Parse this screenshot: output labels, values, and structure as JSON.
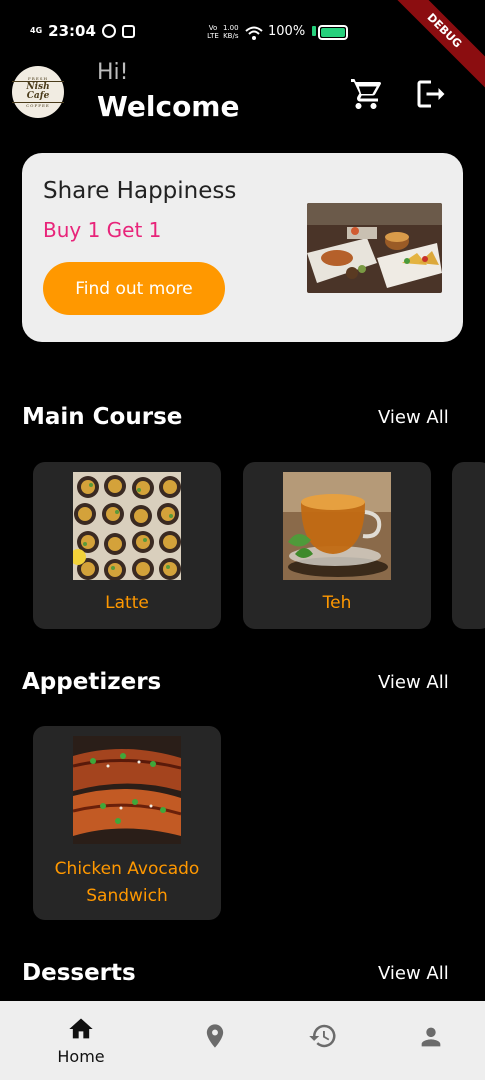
{
  "status_bar": {
    "network": "4G",
    "time": "23:04",
    "lte_label": "Vo LTE",
    "speed": "1.00",
    "speed_unit": "KB/s",
    "battery": "100%"
  },
  "debug_banner": "DEBUG",
  "header": {
    "logo_top": "FRESH",
    "logo_name": "Nish Cafe",
    "logo_bottom": "COFFEE",
    "greeting": "Hi!",
    "welcome": "Welcome",
    "cart_icon": "cart-icon",
    "logout_icon": "logout-icon"
  },
  "promo": {
    "title": "Share Happiness",
    "subtitle": "Buy 1 Get 1",
    "button_label": "Find out more",
    "accent_color": "#e8247a",
    "button_color": "#ff9800"
  },
  "sections": [
    {
      "title": "Main Course",
      "view_all": "View All",
      "items": [
        {
          "name": "Latte"
        },
        {
          "name": "Teh"
        }
      ]
    },
    {
      "title": "Appetizers",
      "view_all": "View All",
      "items": [
        {
          "name": "Chicken Avocado Sandwich"
        }
      ]
    },
    {
      "title": "Desserts",
      "view_all": "View All",
      "items": []
    }
  ],
  "bottom_nav": {
    "items": [
      {
        "icon": "home-icon",
        "label": "Home",
        "active": true
      },
      {
        "icon": "location-icon",
        "label": "",
        "active": false
      },
      {
        "icon": "history-icon",
        "label": "",
        "active": false
      },
      {
        "icon": "profile-icon",
        "label": "",
        "active": false
      }
    ]
  }
}
